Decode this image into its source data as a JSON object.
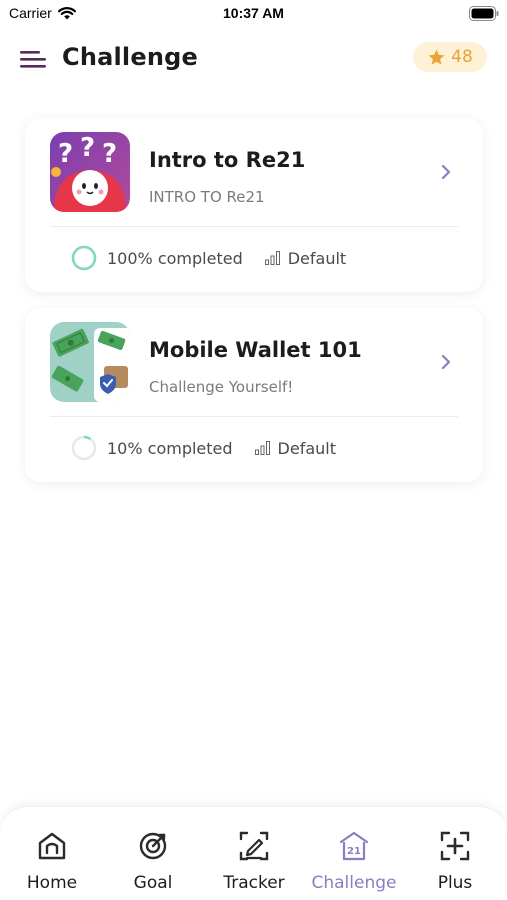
{
  "status_bar": {
    "carrier": "Carrier",
    "time": "10:37 AM"
  },
  "header": {
    "title": "Challenge",
    "points": "48",
    "menu_icon": "hamburger-menu-icon",
    "points_icon": "star-icon"
  },
  "colors": {
    "accent": "#8d7cc3",
    "star": "#e6a437",
    "badge_bg": "#fdf1d6",
    "progress_ring": "#7fd8bf",
    "chevron": "#8d7cc3"
  },
  "challenges": [
    {
      "title": "Intro to Re21",
      "subtitle": "INTRO TO Re21",
      "progress_text": "100% completed",
      "progress": 1.0,
      "level": "Default"
    },
    {
      "title": "Mobile Wallet 101",
      "subtitle": "Challenge Yourself!",
      "progress_text": "10% completed",
      "progress": 0.1,
      "level": "Default"
    }
  ],
  "nav": {
    "active": "Challenge",
    "items": [
      {
        "label": "Home",
        "icon": "home-icon"
      },
      {
        "label": "Goal",
        "icon": "goal-icon"
      },
      {
        "label": "Tracker",
        "icon": "tracker-icon"
      },
      {
        "label": "Challenge",
        "icon": "challenge-icon"
      },
      {
        "label": "Plus",
        "icon": "plus-icon"
      }
    ]
  }
}
